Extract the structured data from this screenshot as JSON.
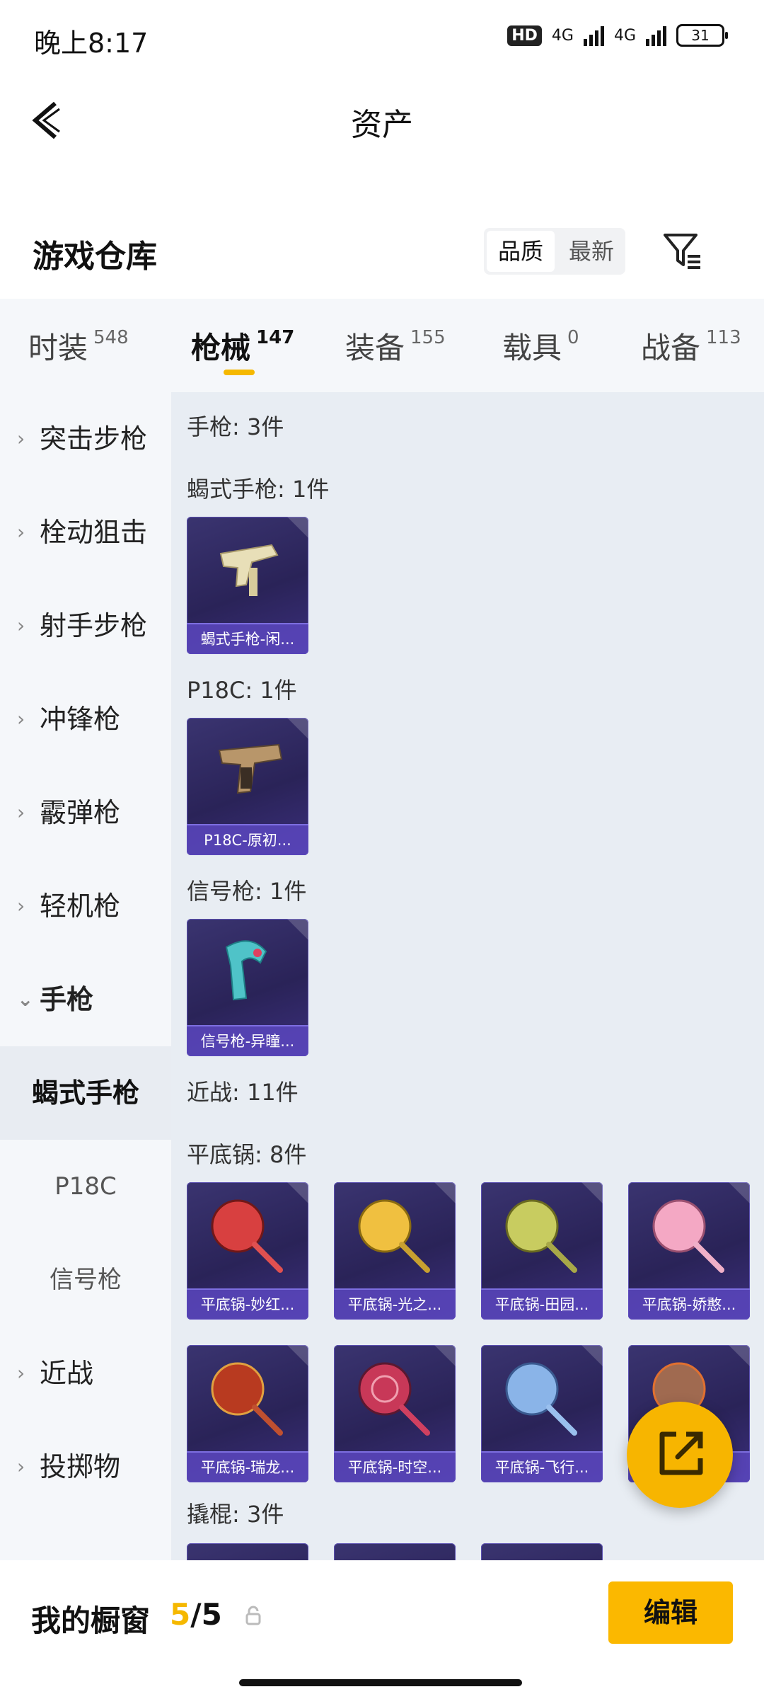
{
  "status_bar": {
    "time": "晚上8:17",
    "hd": "HD",
    "net1": "4G",
    "net2": "4G",
    "battery": "31"
  },
  "header": {
    "title": "资产"
  },
  "warehouse": {
    "title": "游戏仓库",
    "sort_options": [
      "品质",
      "最新"
    ],
    "sort_selected": "品质"
  },
  "tabs": [
    {
      "label": "时装",
      "count": "548"
    },
    {
      "label": "枪械",
      "count": "147"
    },
    {
      "label": "装备",
      "count": "155"
    },
    {
      "label": "载具",
      "count": "0"
    },
    {
      "label": "战备",
      "count": "113"
    }
  ],
  "active_tab": "枪械",
  "sidebar": {
    "items": [
      "突击步枪",
      "栓动狙击",
      "射手步枪",
      "冲锋枪",
      "霰弹枪",
      "轻机枪",
      "手枪"
    ],
    "sub_items": [
      "蝎式手枪",
      "P18C",
      "信号枪"
    ],
    "items_after": [
      "近战",
      "投掷物"
    ]
  },
  "content": {
    "pistol_header": "手枪: 3件",
    "groups": [
      {
        "title": "蝎式手枪: 1件",
        "items": [
          "蝎式手枪-闲..."
        ]
      },
      {
        "title": "P18C: 1件",
        "items": [
          "P18C-原初..."
        ]
      },
      {
        "title": "信号枪: 1件",
        "items": [
          "信号枪-异瞳..."
        ]
      }
    ],
    "melee_header": "近战: 11件",
    "pan_group": {
      "title": "平底锅: 8件",
      "items": [
        "平底锅-妙红...",
        "平底锅-光之...",
        "平底锅-田园...",
        "平底锅-娇憨...",
        "平底锅-瑞龙...",
        "平底锅-时空...",
        "平底锅-飞行...",
        "平底锅-..."
      ]
    },
    "crowbar_header": "撬棍: 3件"
  },
  "bottom_bar": {
    "label": "我的橱窗",
    "used": "5",
    "total": "/5",
    "edit_label": "编辑"
  },
  "colors": {
    "accent": "#f5b800",
    "card_bg": "#2a2358",
    "content_bg": "#e8edf3"
  },
  "icons": [
    "back-arrow-icon",
    "filter-icon",
    "chevron-right-icon",
    "chevron-down-icon",
    "share-icon",
    "lock-icon"
  ]
}
